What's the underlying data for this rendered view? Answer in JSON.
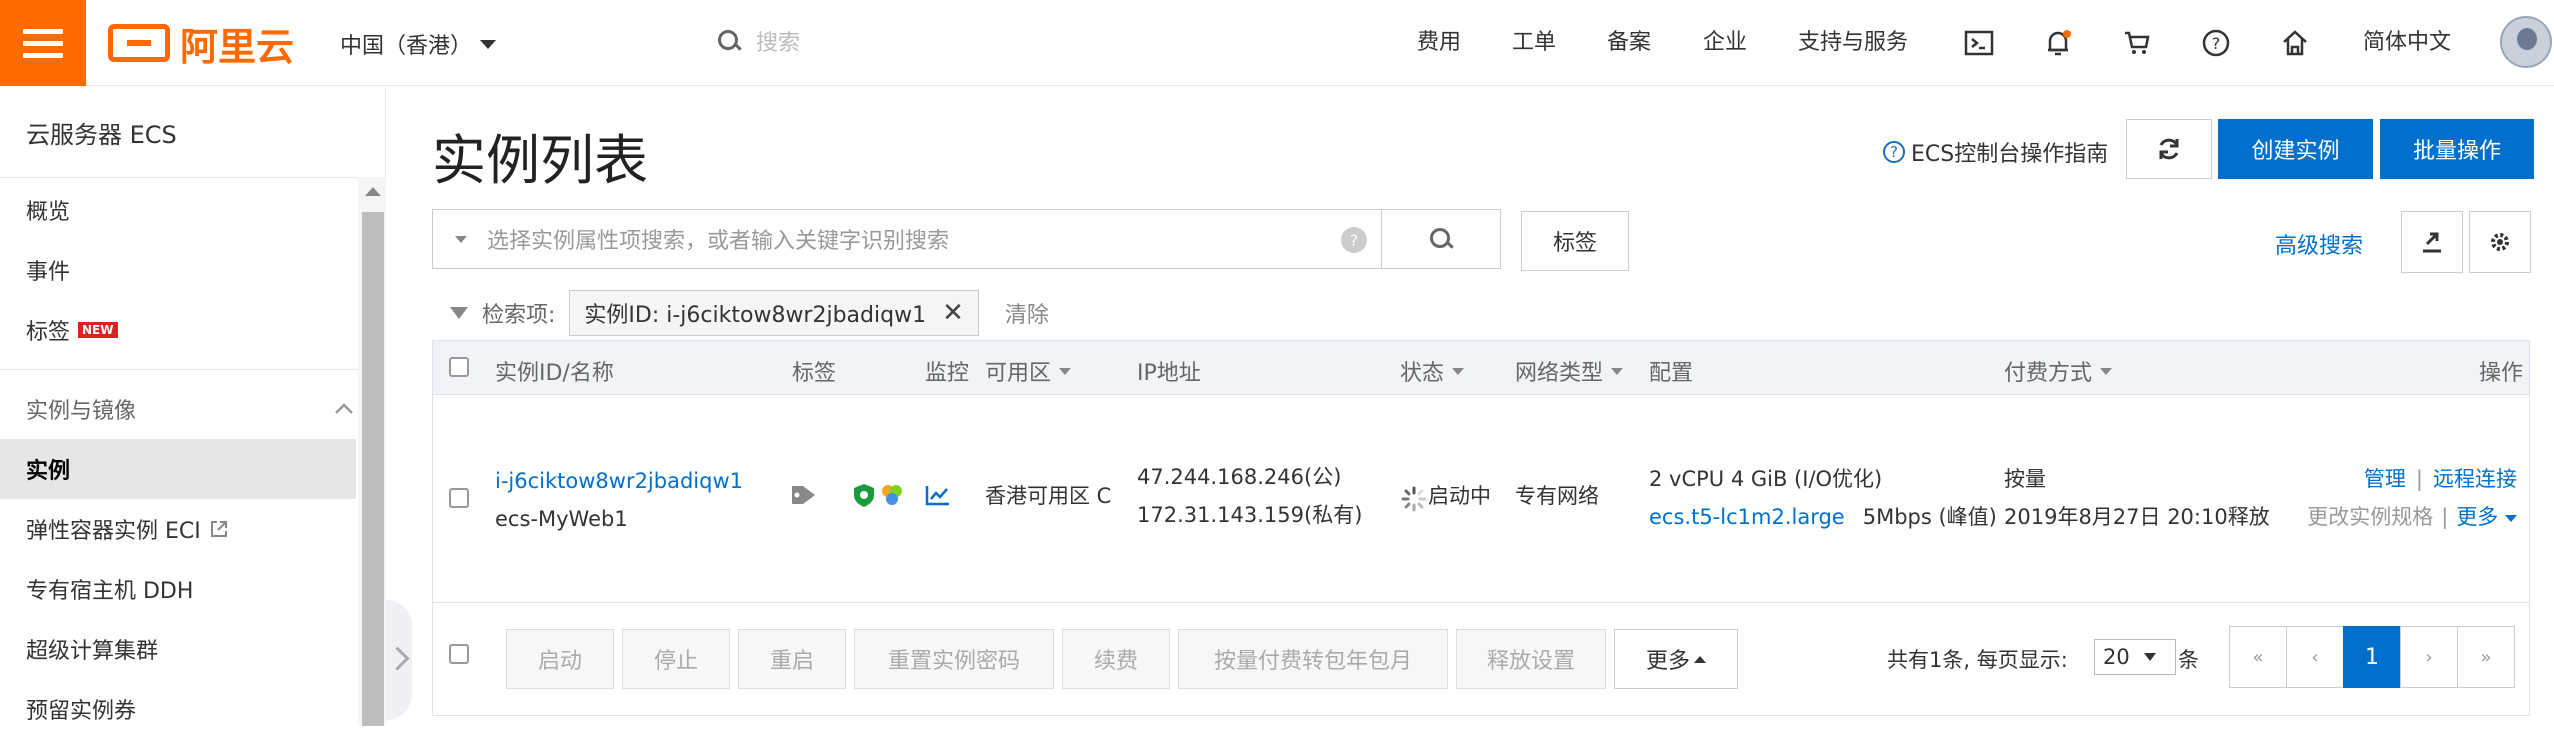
{
  "header": {
    "logo_text": "阿里云",
    "region": "中国（香港）",
    "search_placeholder": "搜索",
    "nav": [
      "费用",
      "工单",
      "备案",
      "企业",
      "支持与服务"
    ],
    "language": "简体中文"
  },
  "sidebar": {
    "title": "云服务器 ECS",
    "items": [
      {
        "label": "概览"
      },
      {
        "label": "事件"
      },
      {
        "label": "标签",
        "badge": "NEW"
      },
      {
        "label": "实例与镜像"
      },
      {
        "label": "实例"
      },
      {
        "label": "弹性容器实例 ECI"
      },
      {
        "label": "专有宿主机 DDH"
      },
      {
        "label": "超级计算集群"
      },
      {
        "label": "预留实例券"
      }
    ]
  },
  "main": {
    "title": "实例列表",
    "guide_link": "ECS控制台操作指南",
    "create_button": "创建实例",
    "batch_button": "批量操作",
    "filter_placeholder": "选择实例属性项搜索，或者输入关键字识别搜索",
    "tag_button": "标签",
    "advanced_search": "高级搜索",
    "filter_label": "检索项:",
    "filter_chip": "实例ID: i-j6ciktow8wr2jbadiqw1",
    "clear": "清除",
    "columns": [
      "实例ID/名称",
      "标签",
      "监控",
      "可用区",
      "IP地址",
      "状态",
      "网络类型",
      "配置",
      "付费方式",
      "操作"
    ],
    "row": {
      "instance_id": "i-j6ciktow8wr2jbadiqw1",
      "instance_name": "ecs-MyWeb1",
      "zone": "香港可用区 C",
      "ip_public": "47.244.168.246(公)",
      "ip_private": "172.31.143.159(私有)",
      "status": "启动中",
      "network": "专有网络",
      "config_line1": "2 vCPU 4 GiB (I/O优化)",
      "config_type": "ecs.t5-lc1m2.large",
      "config_bw": "5Mbps (峰值)",
      "pay_type": "按量",
      "release_time": "2019年8月27日 20:10释放",
      "op_manage": "管理",
      "op_sep": "|",
      "op_remote": "远程连接",
      "op_change": "更改实例规格",
      "op_more": "更多"
    },
    "actions": [
      "启动",
      "停止",
      "重启",
      "重置实例密码",
      "续费",
      "按量付费转包年包月",
      "释放设置",
      "更多"
    ],
    "total": "共有1条, 每页显示:",
    "page_size": "20",
    "page_unit": "条",
    "pages": [
      "«",
      "‹",
      "1",
      "›",
      "»"
    ]
  }
}
